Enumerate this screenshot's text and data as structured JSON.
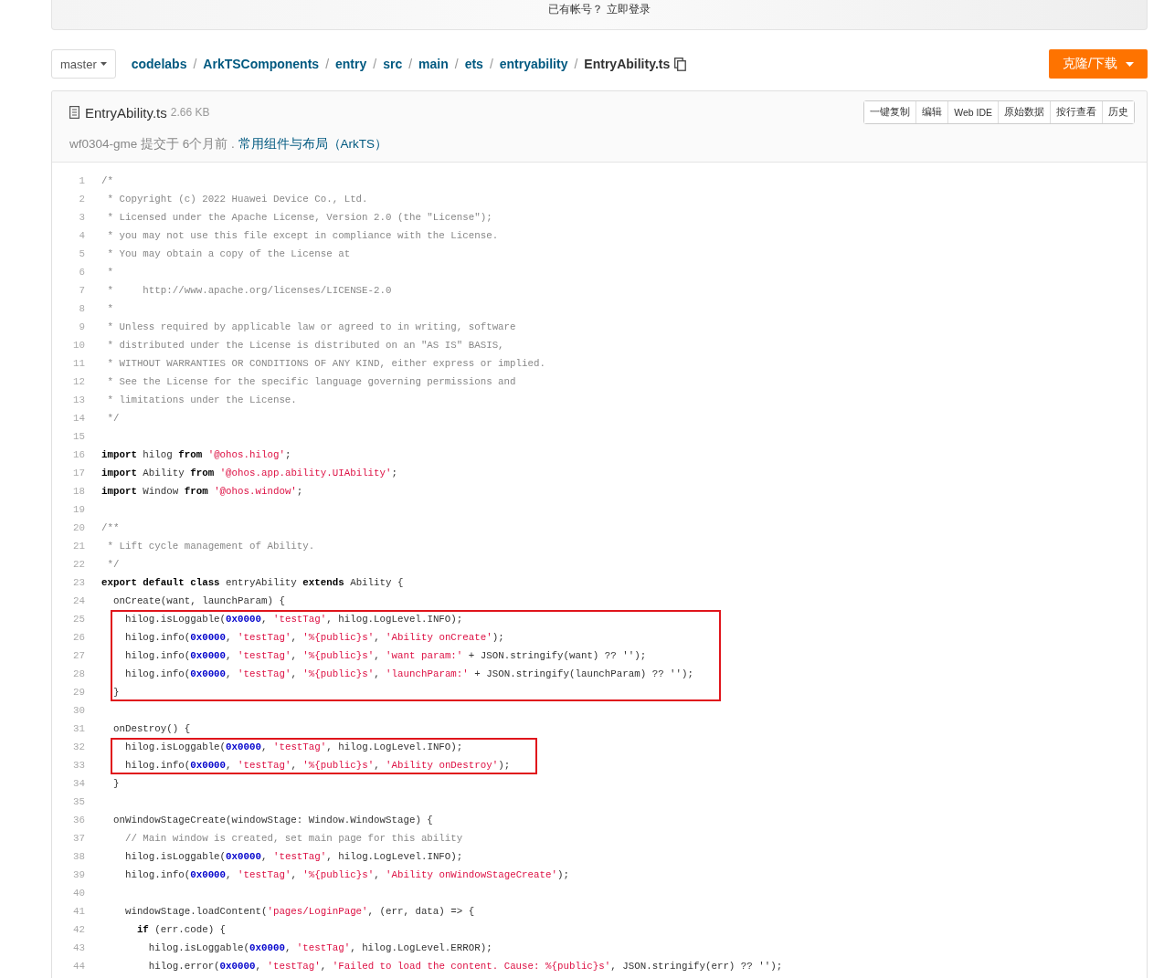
{
  "banner": {
    "text": "已有帐号？ 立即登录"
  },
  "toolbar": {
    "branch": "master",
    "path": [
      {
        "text": "codelabs"
      },
      {
        "separator": "/",
        "text": "ArkTSComponents"
      },
      {
        "separator": "/",
        "text": "entry"
      },
      {
        "separator": "/",
        "text": "src"
      },
      {
        "separator": "/",
        "text": "main"
      },
      {
        "separator": "/",
        "text": "ets"
      },
      {
        "separator": "/",
        "text": "entryability"
      },
      {
        "separator": "/",
        "text": "EntryAbility.ts"
      }
    ],
    "clone_button": "克隆/下载"
  },
  "file": {
    "name": "EntryAbility.ts",
    "size": "2.66 KB",
    "actions": [
      "一键复制",
      "编辑",
      "Web IDE",
      "原始数据",
      "按行查看",
      "历史"
    ],
    "commit": {
      "author": "wf0304-gme",
      "time": "提交于 6个月前 .",
      "message": "常用组件与布局（ArkTS）"
    }
  },
  "code": {
    "lines": [
      {
        "number": "1",
        "marked": false,
        "tokens": [
          {
            "kind": "comment",
            "text": "/*"
          }
        ]
      },
      {
        "number": "2",
        "marked": false,
        "tokens": [
          {
            "kind": "comment",
            "text": " * Copyright (c) 2022 Huawei Device Co., Ltd."
          }
        ]
      },
      {
        "number": "3",
        "marked": false,
        "tokens": [
          {
            "kind": "comment",
            "text": " * Licensed under the Apache License, Version 2.0 (the \"License\");"
          }
        ]
      },
      {
        "number": "4",
        "marked": false,
        "tokens": [
          {
            "kind": "comment",
            "text": " * you may not use this file except in compliance with the License."
          }
        ]
      },
      {
        "number": "5",
        "marked": false,
        "tokens": [
          {
            "kind": "comment",
            "text": " * You may obtain a copy of the License at"
          }
        ]
      },
      {
        "number": "6",
        "marked": false,
        "tokens": [
          {
            "kind": "comment",
            "text": " *"
          }
        ]
      },
      {
        "number": "7",
        "marked": false,
        "tokens": [
          {
            "kind": "comment",
            "text": " *     http://www.apache.org/licenses/LICENSE-2.0"
          }
        ]
      },
      {
        "number": "8",
        "marked": false,
        "tokens": [
          {
            "kind": "comment",
            "text": " *"
          }
        ]
      },
      {
        "number": "9",
        "marked": false,
        "tokens": [
          {
            "kind": "comment",
            "text": " * Unless required by applicable law or agreed to in writing, software"
          }
        ]
      },
      {
        "number": "10",
        "marked": false,
        "tokens": [
          {
            "kind": "comment",
            "text": " * distributed under the License is distributed on an \"AS IS\" BASIS,"
          }
        ]
      },
      {
        "number": "11",
        "marked": false,
        "tokens": [
          {
            "kind": "comment",
            "text": " * WITHOUT WARRANTIES OR CONDITIONS OF ANY KIND, either express or implied."
          }
        ]
      },
      {
        "number": "12",
        "marked": false,
        "tokens": [
          {
            "kind": "comment",
            "text": " * See the License for the specific language governing permissions and"
          }
        ]
      },
      {
        "number": "13",
        "marked": false,
        "tokens": [
          {
            "kind": "comment",
            "text": " * limitations under the License."
          }
        ]
      },
      {
        "number": "14",
        "marked": false,
        "tokens": [
          {
            "kind": "comment",
            "text": " */"
          }
        ]
      },
      {
        "number": "15",
        "marked": false
      },
      {
        "number": "16",
        "marked": false,
        "tokens": [
          {
            "kind": "keyword",
            "text": "import"
          },
          {
            "kind": "plain",
            "text": " hilog "
          },
          {
            "kind": "keyword",
            "text": "from "
          },
          {
            "kind": "string",
            "text": "'@ohos.hilog'"
          },
          {
            "kind": "plain",
            "text": ";"
          }
        ]
      },
      {
        "number": "17",
        "marked": false,
        "tokens": [
          {
            "kind": "keyword",
            "text": "import"
          },
          {
            "kind": "plain",
            "text": " Ability "
          },
          {
            "kind": "keyword",
            "text": "from "
          },
          {
            "kind": "string",
            "text": "'@ohos.app.ability.UIAbility'"
          },
          {
            "kind": "plain",
            "text": ";"
          }
        ]
      },
      {
        "number": "18",
        "marked": false,
        "tokens": [
          {
            "kind": "keyword",
            "text": "import"
          },
          {
            "kind": "plain",
            "text": " Window "
          },
          {
            "kind": "keyword",
            "text": "from "
          },
          {
            "kind": "string",
            "text": "'@ohos.window'"
          },
          {
            "kind": "plain",
            "text": ";"
          }
        ]
      },
      {
        "number": "19",
        "marked": false
      },
      {
        "number": "20",
        "marked": false,
        "tokens": [
          {
            "kind": "comment",
            "text": "/**"
          }
        ]
      },
      {
        "number": "21",
        "marked": false,
        "tokens": [
          {
            "kind": "comment",
            "text": " * Lift cycle management of Ability."
          }
        ]
      },
      {
        "number": "22",
        "marked": false,
        "tokens": [
          {
            "kind": "comment",
            "text": " */"
          }
        ]
      },
      {
        "number": "23",
        "marked": false,
        "tokens": [
          {
            "kind": "keyword",
            "text": "export default class"
          },
          {
            "kind": "plain",
            "text": " entryAbility "
          },
          {
            "kind": "keyword",
            "text": "extends"
          },
          {
            "kind": "plain",
            "text": " Ability {"
          }
        ]
      },
      {
        "number": "24",
        "marked": false,
        "tokens": [
          {
            "kind": "plain",
            "text": "  onCreate(want, launchParam) {"
          }
        ]
      },
      {
        "number": "25",
        "marked": true,
        "tokens": [
          {
            "kind": "plain",
            "text": "    hilog.isLoggable("
          },
          {
            "kind": "number",
            "text": "0x0000"
          },
          {
            "kind": "plain",
            "text": ", "
          },
          {
            "kind": "string",
            "text": "'testTag'"
          },
          {
            "kind": "plain",
            "text": ", hilog.LogLevel.INFO);"
          }
        ]
      },
      {
        "number": "26",
        "marked": true,
        "tokens": [
          {
            "kind": "plain",
            "text": "    hilog.info("
          },
          {
            "kind": "number",
            "text": "0x0000"
          },
          {
            "kind": "plain",
            "text": ", "
          },
          {
            "kind": "string",
            "text": "'testTag'"
          },
          {
            "kind": "plain",
            "text": ", "
          },
          {
            "kind": "string",
            "text": "'%{public}s'"
          },
          {
            "kind": "plain",
            "text": ", "
          },
          {
            "kind": "string",
            "text": "'Ability onCreate'"
          },
          {
            "kind": "plain",
            "text": ");"
          }
        ]
      },
      {
        "number": "27",
        "marked": true,
        "tokens": [
          {
            "kind": "plain",
            "text": "    hilog.info("
          },
          {
            "kind": "number",
            "text": "0x0000"
          },
          {
            "kind": "plain",
            "text": ", "
          },
          {
            "kind": "string",
            "text": "'testTag'"
          },
          {
            "kind": "plain",
            "text": ", "
          },
          {
            "kind": "string",
            "text": "'%{public}s'"
          },
          {
            "kind": "plain",
            "text": ", "
          },
          {
            "kind": "string",
            "text": "'want param:'"
          },
          {
            "kind": "plain",
            "text": " + JSON.stringify(want) ?? '');"
          }
        ]
      },
      {
        "number": "28",
        "marked": true,
        "tokens": [
          {
            "kind": "plain",
            "text": "    hilog.info("
          },
          {
            "kind": "number",
            "text": "0x0000"
          },
          {
            "kind": "plain",
            "text": ", "
          },
          {
            "kind": "string",
            "text": "'testTag'"
          },
          {
            "kind": "plain",
            "text": ", "
          },
          {
            "kind": "string",
            "text": "'%{public}s'"
          },
          {
            "kind": "plain",
            "text": ", "
          },
          {
            "kind": "string",
            "text": "'launchParam:'"
          },
          {
            "kind": "plain",
            "text": " + JSON.stringify(launchParam) ?? '');"
          }
        ]
      },
      {
        "number": "29",
        "marked": true,
        "tokens": [
          {
            "kind": "plain",
            "text": "  }"
          }
        ]
      },
      {
        "number": "30",
        "marked": false
      },
      {
        "number": "31",
        "marked": false,
        "tokens": [
          {
            "kind": "plain",
            "text": "  onDestroy() {"
          }
        ]
      },
      {
        "number": "32",
        "marked": true,
        "tokens": [
          {
            "kind": "plain",
            "text": "    hilog.isLoggable("
          },
          {
            "kind": "number",
            "text": "0x0000"
          },
          {
            "kind": "plain",
            "text": ", "
          },
          {
            "kind": "string",
            "text": "'testTag'"
          },
          {
            "kind": "plain",
            "text": ", hilog.LogLevel.INFO);"
          }
        ]
      },
      {
        "number": "33",
        "marked": true,
        "tokens": [
          {
            "kind": "plain",
            "text": "    hilog.info("
          },
          {
            "kind": "number",
            "text": "0x0000"
          },
          {
            "kind": "plain",
            "text": ", "
          },
          {
            "kind": "string",
            "text": "'testTag'"
          },
          {
            "kind": "plain",
            "text": ", "
          },
          {
            "kind": "string",
            "text": "'%{public}s'"
          },
          {
            "kind": "plain",
            "text": ", "
          },
          {
            "kind": "string",
            "text": "'Ability onDestroy'"
          },
          {
            "kind": "plain",
            "text": ");"
          }
        ]
      },
      {
        "number": "34",
        "marked": false,
        "tokens": [
          {
            "kind": "plain",
            "text": "  }"
          }
        ]
      },
      {
        "number": "35",
        "marked": false
      },
      {
        "number": "36",
        "marked": false,
        "tokens": [
          {
            "kind": "plain",
            "text": "  onWindowStageCreate(windowStage: Window.WindowStage) {"
          }
        ]
      },
      {
        "number": "37",
        "marked": false,
        "tokens": [
          {
            "kind": "comment",
            "text": "    // Main window is created, set main page for this ability"
          }
        ]
      },
      {
        "number": "38",
        "marked": false,
        "tokens": [
          {
            "kind": "plain",
            "text": "    hilog.isLoggable("
          },
          {
            "kind": "number",
            "text": "0x0000"
          },
          {
            "kind": "plain",
            "text": ", "
          },
          {
            "kind": "string",
            "text": "'testTag'"
          },
          {
            "kind": "plain",
            "text": ", hilog.LogLevel.INFO);"
          }
        ]
      },
      {
        "number": "39",
        "marked": false,
        "tokens": [
          {
            "kind": "plain",
            "text": "    hilog.info("
          },
          {
            "kind": "number",
            "text": "0x0000"
          },
          {
            "kind": "plain",
            "text": ", "
          },
          {
            "kind": "string",
            "text": "'testTag'"
          },
          {
            "kind": "plain",
            "text": ", "
          },
          {
            "kind": "string",
            "text": "'%{public}s'"
          },
          {
            "kind": "plain",
            "text": ", "
          },
          {
            "kind": "string",
            "text": "'Ability onWindowStageCreate'"
          },
          {
            "kind": "plain",
            "text": ");"
          }
        ]
      },
      {
        "number": "40",
        "marked": false
      },
      {
        "number": "41",
        "marked": false,
        "tokens": [
          {
            "kind": "plain",
            "text": "    windowStage.loadContent("
          },
          {
            "kind": "string",
            "text": "'pages/LoginPage'"
          },
          {
            "kind": "plain",
            "text": ", (err, data) => {"
          }
        ]
      },
      {
        "number": "42",
        "marked": false,
        "tokens": [
          {
            "kind": "keyword",
            "text": "      if"
          },
          {
            "kind": "plain",
            "text": " (err.code) {"
          }
        ]
      },
      {
        "number": "43",
        "marked": false,
        "tokens": [
          {
            "kind": "plain",
            "text": "        hilog.isLoggable("
          },
          {
            "kind": "number",
            "text": "0x0000"
          },
          {
            "kind": "plain",
            "text": ", "
          },
          {
            "kind": "string",
            "text": "'testTag'"
          },
          {
            "kind": "plain",
            "text": ", hilog.LogLevel.ERROR);"
          }
        ]
      },
      {
        "number": "44",
        "marked": false,
        "tokens": [
          {
            "kind": "plain",
            "text": "        hilog.error("
          },
          {
            "kind": "number",
            "text": "0x0000"
          },
          {
            "kind": "plain",
            "text": ", "
          },
          {
            "kind": "string",
            "text": "'testTag'"
          },
          {
            "kind": "plain",
            "text": ", "
          },
          {
            "kind": "string",
            "text": "'Failed to load the content. Cause: %{public}s'"
          },
          {
            "kind": "plain",
            "text": ", JSON.stringify(err) ?? '');"
          }
        ]
      }
    ]
  }
}
